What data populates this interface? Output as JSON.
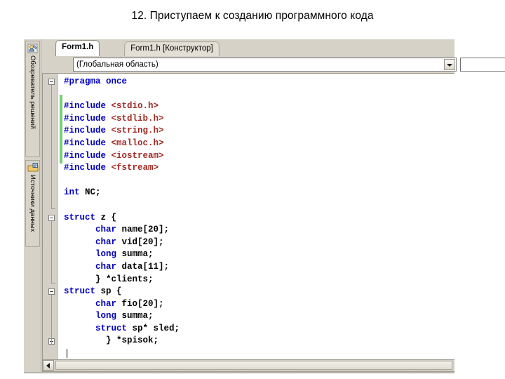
{
  "slide": {
    "title": "12. Приступаем к созданию программного кода"
  },
  "ide": {
    "side_dock": {
      "tabs": [
        {
          "label": "Обозреватель решений",
          "icon": "solution-explorer-icon"
        },
        {
          "label": "Источники данных",
          "icon": "data-sources-icon"
        }
      ]
    },
    "document_tabs": [
      {
        "label": "Form1.h",
        "active": true
      },
      {
        "label": "Form1.h [Конструктор]",
        "active": false
      }
    ],
    "navigation_bar": {
      "scope_combo": {
        "value": "(Глобальная область)",
        "placeholder": "(Глобальная область)",
        "arrow_icon": "chevron-down-icon"
      },
      "member_combo": {
        "value": "",
        "placeholder": "",
        "arrow_icon": "chevron-down-icon"
      }
    },
    "scrollbar": {
      "left_arrow_icon": "arrow-left-icon"
    },
    "colors": {
      "keyword": "#0000c0",
      "preprocessor": "#0000c0",
      "string": "#9e2b25",
      "identifier": "#000000",
      "change_bar": "#76d176",
      "editor_background": "#ffffff",
      "chrome": "#d6d2c7"
    },
    "code_lines": [
      {
        "outline": "collapse",
        "tokens": [
          {
            "t": "#pragma once",
            "c": "pp"
          }
        ]
      },
      {
        "outline": "",
        "tokens": []
      },
      {
        "outline": "",
        "tokens": [
          {
            "t": "#include ",
            "c": "pp"
          },
          {
            "t": "<stdio.h>",
            "c": "str"
          }
        ]
      },
      {
        "outline": "",
        "tokens": [
          {
            "t": "#include ",
            "c": "pp"
          },
          {
            "t": "<stdlib.h>",
            "c": "str"
          }
        ]
      },
      {
        "outline": "",
        "tokens": [
          {
            "t": "#include ",
            "c": "pp"
          },
          {
            "t": "<string.h>",
            "c": "str"
          }
        ]
      },
      {
        "outline": "",
        "tokens": [
          {
            "t": "#include ",
            "c": "pp"
          },
          {
            "t": "<malloc.h>",
            "c": "str"
          }
        ]
      },
      {
        "outline": "",
        "tokens": [
          {
            "t": "#include ",
            "c": "pp"
          },
          {
            "t": "<iostream>",
            "c": "str"
          }
        ]
      },
      {
        "outline": "",
        "tokens": [
          {
            "t": "#include ",
            "c": "pp"
          },
          {
            "t": "<fstream>",
            "c": "str"
          }
        ]
      },
      {
        "outline": "",
        "tokens": []
      },
      {
        "outline": "",
        "tokens": [
          {
            "t": "int",
            "c": "kw"
          },
          {
            "t": " NC;",
            "c": "id"
          }
        ]
      },
      {
        "outline": "",
        "tokens": []
      },
      {
        "outline": "collapse",
        "tokens": [
          {
            "t": "struct",
            "c": "kw"
          },
          {
            "t": " z {",
            "c": "id"
          }
        ]
      },
      {
        "outline": "",
        "tokens": [
          {
            "t": "      ",
            "c": "pl"
          },
          {
            "t": "char",
            "c": "kw"
          },
          {
            "t": " name[20];",
            "c": "id"
          }
        ]
      },
      {
        "outline": "",
        "tokens": [
          {
            "t": "      ",
            "c": "pl"
          },
          {
            "t": "char",
            "c": "kw"
          },
          {
            "t": " vid[20];",
            "c": "id"
          }
        ]
      },
      {
        "outline": "",
        "tokens": [
          {
            "t": "      ",
            "c": "pl"
          },
          {
            "t": "long",
            "c": "kw"
          },
          {
            "t": " summa;",
            "c": "id"
          }
        ]
      },
      {
        "outline": "",
        "tokens": [
          {
            "t": "      ",
            "c": "pl"
          },
          {
            "t": "char",
            "c": "kw"
          },
          {
            "t": " data[11];",
            "c": "id"
          }
        ]
      },
      {
        "outline": "",
        "tokens": [
          {
            "t": "      } *clients;",
            "c": "id"
          }
        ]
      },
      {
        "outline": "collapse",
        "tokens": [
          {
            "t": "struct",
            "c": "kw"
          },
          {
            "t": " sp {",
            "c": "id"
          }
        ]
      },
      {
        "outline": "",
        "tokens": [
          {
            "t": "      ",
            "c": "pl"
          },
          {
            "t": "char",
            "c": "kw"
          },
          {
            "t": " fio[20];",
            "c": "id"
          }
        ]
      },
      {
        "outline": "",
        "tokens": [
          {
            "t": "      ",
            "c": "pl"
          },
          {
            "t": "long",
            "c": "kw"
          },
          {
            "t": " summa;",
            "c": "id"
          }
        ]
      },
      {
        "outline": "",
        "tokens": [
          {
            "t": "      ",
            "c": "pl"
          },
          {
            "t": "struct",
            "c": "kw"
          },
          {
            "t": " sp* sled;",
            "c": "id"
          }
        ]
      },
      {
        "outline": "collapse",
        "tokens": [
          {
            "t": "        } *spisok;",
            "c": "id"
          }
        ]
      },
      {
        "outline": "",
        "tokens": []
      }
    ]
  }
}
